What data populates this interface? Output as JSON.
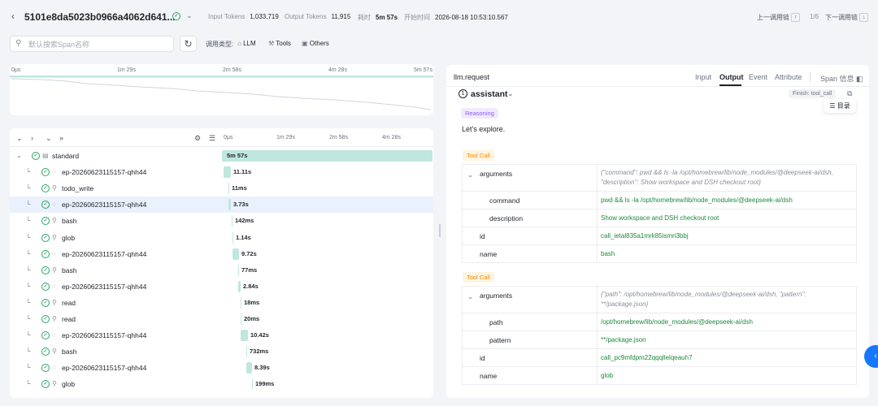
{
  "header": {
    "trace_id": "5101e8da5023b0966a4062d641...",
    "input_tokens_label": "Input Tokens",
    "input_tokens": "1,033,719",
    "output_tokens_label": "Output Tokens",
    "output_tokens": "11,915",
    "duration_label": "耗时",
    "duration": "5m 57s",
    "start_label": "开始时间",
    "start_time": "2026-08-18 10:53:10.567",
    "prev_label": "上一调用链",
    "page": "1/6",
    "next_label": "下一调用链"
  },
  "search": {
    "placeholder": "默认搜索Span名称"
  },
  "filters": {
    "label": "调用类型:",
    "llm": "LLM",
    "tools": "Tools",
    "others": "Others"
  },
  "ruler": [
    "0μs",
    "1m 29s",
    "2m 58s",
    "4m 28s",
    "5m 57s"
  ],
  "tree_ruler": [
    "0μs",
    "1m 29s",
    "2m 58s",
    "4m 28s"
  ],
  "rows": [
    {
      "name": "standard",
      "duration": "5m 57s"
    },
    {
      "name": "ep-20260623115157-qhh44",
      "duration": "11.11s"
    },
    {
      "name": "todo_write",
      "duration": "11ms"
    },
    {
      "name": "ep-20260623115157-qhh44",
      "duration": "3.73s"
    },
    {
      "name": "bash",
      "duration": "142ms"
    },
    {
      "name": "glob",
      "duration": "1.14s"
    },
    {
      "name": "ep-20260623115157-qhh44",
      "duration": "9.72s"
    },
    {
      "name": "bash",
      "duration": "77ms"
    },
    {
      "name": "ep-20260623115157-qhh44",
      "duration": "2.84s"
    },
    {
      "name": "read",
      "duration": "18ms"
    },
    {
      "name": "read",
      "duration": "20ms"
    },
    {
      "name": "ep-20260623115157-qhh44",
      "duration": "10.42s"
    },
    {
      "name": "bash",
      "duration": "732ms"
    },
    {
      "name": "ep-20260623115157-qhh44",
      "duration": "8.39s"
    },
    {
      "name": "glob",
      "duration": "199ms"
    }
  ],
  "detail": {
    "title": "llm.request",
    "tabs": [
      "Input",
      "Output",
      "Event",
      "Attribute"
    ],
    "span_info": "Span 信息",
    "role_index": "1",
    "role": "assistant",
    "finish": "Finish: tool_call",
    "toc": "目录",
    "reasoning_tag": "Reasoning",
    "reasoning_text": "Let's explore.",
    "tool_call_tag": "Tool Call",
    "tool_calls": [
      {
        "arguments_key": "arguments",
        "arguments_value": "{\"command\": pwd && ls -la /opt/homebrew/lib/node_modules/@deepseek-ai/dsh, \"description\": Show workspace and DSH checkout root}",
        "sub": [
          {
            "key": "command",
            "value": "pwd && ls -la /opt/homebrew/lib/node_modules/@deepseek-ai/dsh"
          },
          {
            "key": "description",
            "value": "Show workspace and DSH checkout root"
          }
        ],
        "id_key": "id",
        "id": "call_ietal835a1mrk85ismri3bbj",
        "name_key": "name",
        "name": "bash"
      },
      {
        "arguments_key": "arguments",
        "arguments_value": "{\"path\": /opt/homebrew/lib/node_modules/@deepseek-ai/dsh, \"pattern\": **/package.json}",
        "sub": [
          {
            "key": "path",
            "value": "/opt/homebrew/lib/node_modules/@deepseek-ai/dsh"
          },
          {
            "key": "pattern",
            "value": "**/package.json"
          }
        ],
        "id_key": "id",
        "id": "call_pc9mfdpm22qqqllelqeauh7",
        "name_key": "name",
        "name": "glob"
      }
    ]
  },
  "colors": {
    "accent": "#1677ff",
    "bar": "#bfe7df",
    "ok": "#2aa65f",
    "value": "#1b8a3a"
  }
}
